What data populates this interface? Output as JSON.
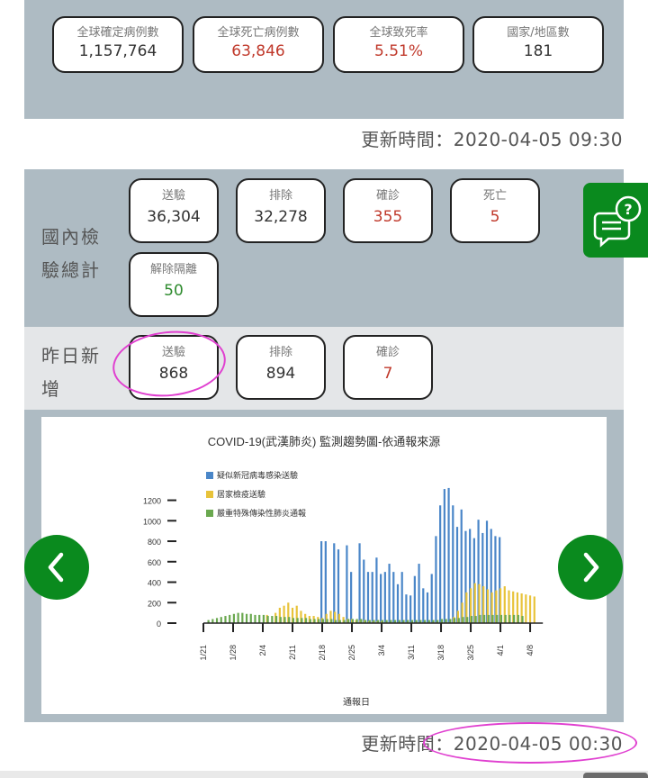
{
  "global": {
    "stats": [
      {
        "label": "全球確定病例數",
        "value": "1,157,764",
        "color": "dark"
      },
      {
        "label": "全球死亡病例數",
        "value": "63,846",
        "color": "red"
      },
      {
        "label": "全球致死率",
        "value": "5.51%",
        "color": "red"
      },
      {
        "label": "國家/地區數",
        "value": "181",
        "color": "dark"
      }
    ],
    "update_time": "更新時間：2020-04-05 09:30"
  },
  "domestic": {
    "label": "國內檢驗總計",
    "stats": [
      {
        "label": "送驗",
        "value": "36,304",
        "color": "dark"
      },
      {
        "label": "排除",
        "value": "32,278",
        "color": "dark"
      },
      {
        "label": "確診",
        "value": "355",
        "color": "red"
      },
      {
        "label": "死亡",
        "value": "5",
        "color": "red"
      },
      {
        "label": "解除隔離",
        "value": "50",
        "color": "green"
      }
    ]
  },
  "daily": {
    "label": "昨日新增",
    "stats": [
      {
        "label": "送驗",
        "value": "868",
        "color": "dark"
      },
      {
        "label": "排除",
        "value": "894",
        "color": "dark"
      },
      {
        "label": "確診",
        "value": "7",
        "color": "red"
      }
    ]
  },
  "chart_update_time": "更新時間：2020-04-05 00:30",
  "icons": {
    "prev": "chevron-left-icon",
    "next": "chevron-right-icon",
    "chat": "chat-question-icon"
  },
  "colors": {
    "panel": "#aebbc3",
    "accent_green": "#0a8a1e",
    "value_red": "#c0392b",
    "value_green": "#2e8b2e",
    "series_blue": "#4a86c8",
    "series_yellow": "#e8c33a",
    "series_green": "#6aa84f",
    "highlight": "#e040d0"
  },
  "chart_data": {
    "type": "bar",
    "title": "COVID-19(武漢肺炎) 監測趨勢圖-依通報來源",
    "xlabel": "通報日",
    "ylabel": "",
    "ylim": [
      0,
      1400
    ],
    "yticks": [
      0,
      200,
      400,
      600,
      800,
      1000,
      1200
    ],
    "x_tick_labels": [
      "1/21",
      "1/28",
      "2/4",
      "2/11",
      "2/18",
      "2/25",
      "3/4",
      "3/11",
      "3/18",
      "3/25",
      "4/1",
      "4/8"
    ],
    "legend_position": "top-left",
    "series": [
      {
        "name": "疑似新冠病毒感染送驗",
        "color": "#4a86c8",
        "start_day": 28,
        "values": [
          800,
          800,
          0,
          780,
          720,
          0,
          760,
          500,
          0,
          780,
          620,
          500,
          500,
          640,
          480,
          500,
          580,
          500,
          380,
          500,
          280,
          270,
          460,
          580,
          340,
          300,
          480,
          850,
          1150,
          1310,
          1320,
          1150,
          940,
          1110,
          900,
          920,
          830,
          1010,
          880,
          1000,
          920,
          850,
          840
        ]
      },
      {
        "name": "居家檢疫送驗",
        "color": "#e8c33a",
        "start_day": 8,
        "values": [
          0,
          0,
          0,
          0,
          0,
          0,
          0,
          80,
          0,
          100,
          150,
          170,
          200,
          150,
          170,
          120,
          90,
          70,
          70,
          60,
          50,
          90,
          120,
          110,
          90,
          60,
          40,
          40,
          30,
          30,
          30,
          20,
          20,
          20,
          20,
          10,
          10,
          10,
          10,
          10,
          10,
          10,
          10,
          10,
          10,
          10,
          10,
          10,
          10,
          10,
          10,
          60,
          120,
          200,
          300,
          340,
          390,
          380,
          360,
          330,
          300,
          320,
          340,
          360,
          320,
          310,
          300,
          290,
          280,
          270,
          260
        ]
      },
      {
        "name": "嚴重特殊傳染性肺炎通報",
        "color": "#6aa84f",
        "start_day": 1,
        "values": [
          30,
          40,
          50,
          60,
          70,
          80,
          90,
          100,
          100,
          90,
          90,
          80,
          80,
          80,
          70,
          70,
          70,
          60,
          60,
          60,
          50,
          50,
          50,
          50,
          40,
          40,
          40,
          40,
          40,
          40,
          30,
          30,
          30,
          40,
          40,
          40,
          40,
          30,
          30,
          30,
          30,
          30,
          30,
          30,
          30,
          30,
          30,
          30,
          30,
          30,
          30,
          30,
          30,
          30,
          30,
          40,
          40,
          40,
          50,
          50,
          60,
          60,
          70,
          70,
          80,
          80,
          80,
          80,
          80,
          80,
          80,
          80,
          80,
          80,
          70
        ]
      }
    ]
  }
}
